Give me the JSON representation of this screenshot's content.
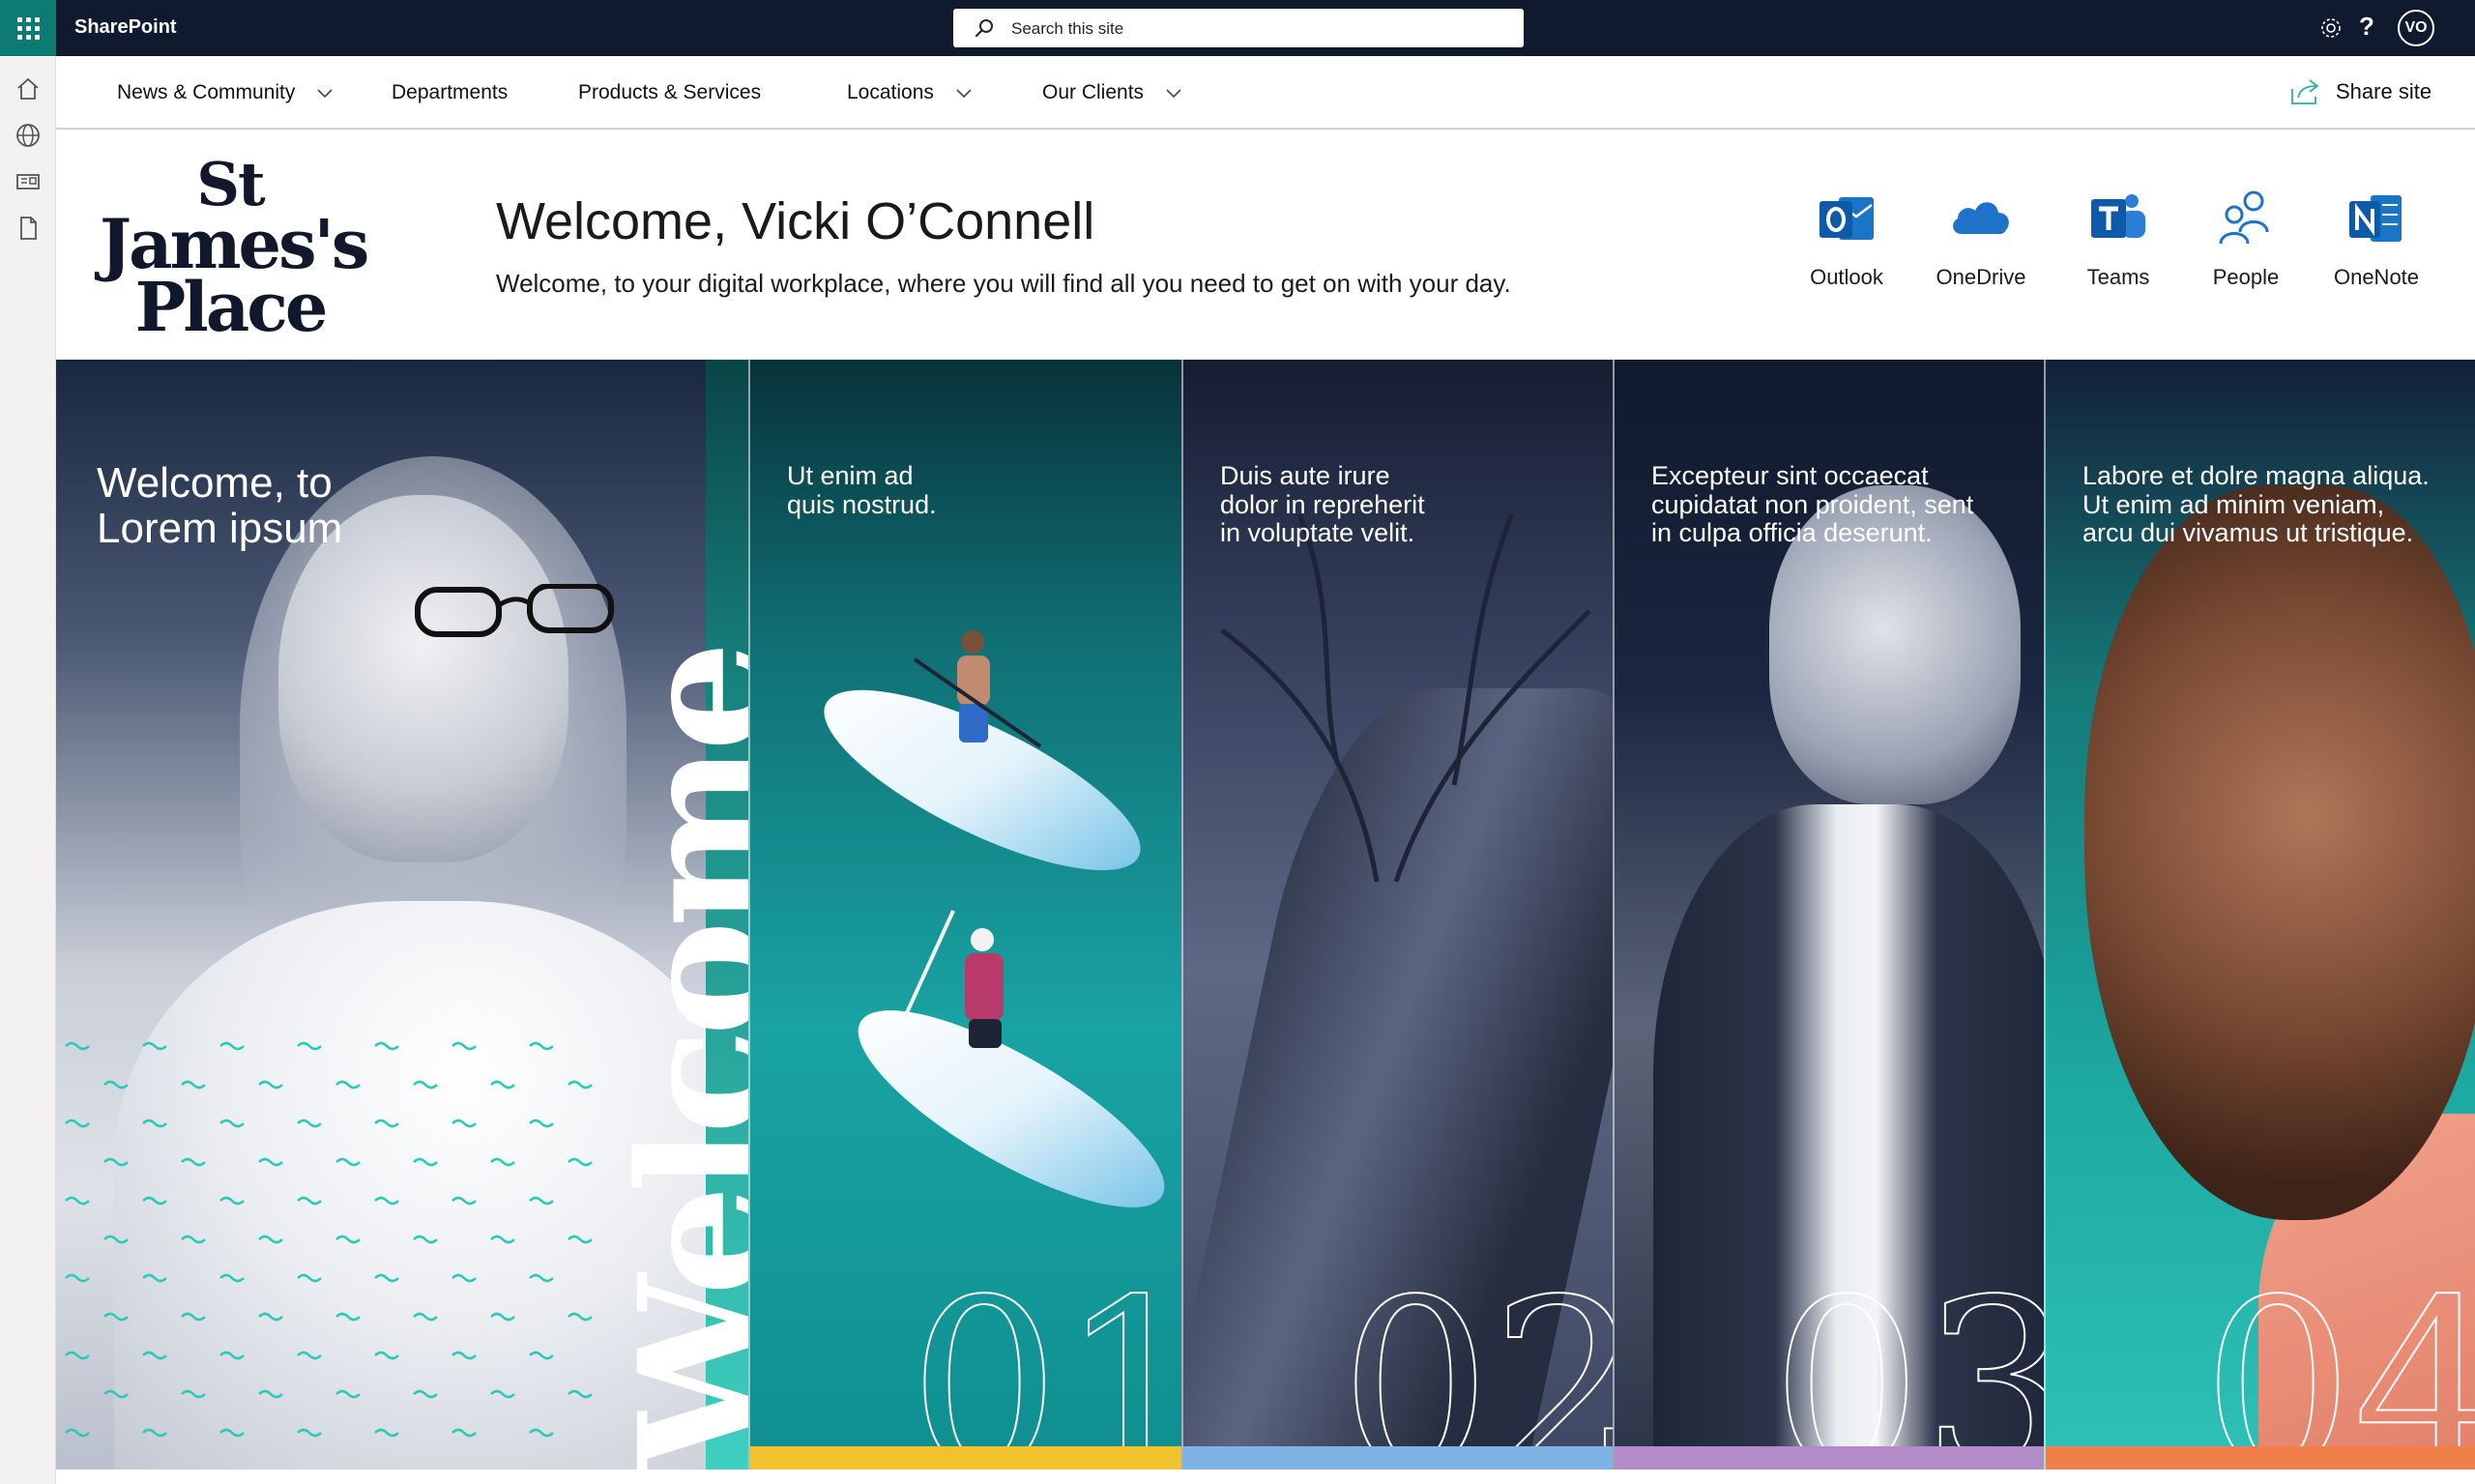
{
  "suitebar": {
    "app_name": "SharePoint",
    "search_placeholder": "Search this site",
    "help_label": "?",
    "avatar_initials": "VO",
    "accent_color": "#0e7a74",
    "bg_color": "#0f1a2e"
  },
  "leftrail": {
    "icons": [
      "home-icon",
      "globe-icon",
      "news-icon",
      "document-icon"
    ]
  },
  "nav": {
    "items": [
      {
        "label": "News & Community",
        "has_dropdown": true
      },
      {
        "label": "Departments",
        "has_dropdown": false
      },
      {
        "label": "Products & Services",
        "has_dropdown": false
      },
      {
        "label": "Locations",
        "has_dropdown": true
      },
      {
        "label": "Our Clients",
        "has_dropdown": true
      }
    ],
    "share_label": "Share site"
  },
  "header": {
    "logo_line1": "St",
    "logo_line2": "James's",
    "logo_line3": "Place",
    "title": "Welcome, Vicki O’Connell",
    "subtitle": "Welcome, to your digital workplace, where you will find all you need to get on with your day.",
    "apps": [
      {
        "label": "Outlook",
        "icon": "outlook-icon"
      },
      {
        "label": "OneDrive",
        "icon": "onedrive-icon"
      },
      {
        "label": "Teams",
        "icon": "teams-icon"
      },
      {
        "label": "People",
        "icon": "people-icon"
      },
      {
        "label": "OneNote",
        "icon": "onenote-icon"
      }
    ]
  },
  "hero": {
    "main_title": "Welcome, to\nLorem ipsum",
    "vertical_word": "Welcome",
    "panels": [
      {
        "text": "Ut enim ad\nquis nostrud.",
        "number": "01",
        "bar_color": "#f2c12e"
      },
      {
        "text": "Duis aute irure\ndolor in repreherit\nin voluptate velit.",
        "number": "02",
        "bar_color": "#7fb2e5"
      },
      {
        "text": "Excepteur sint occaecat\ncupidatat non proident, sent\nin culpa officia deserunt.",
        "number": "03",
        "bar_color": "#b58ac9"
      },
      {
        "text": "Labore et dolre magna aliqua.\nUt enim ad minim veniam,\narcu dui vivamus ut tristique.",
        "number": "04",
        "bar_color": "#f07f4a"
      }
    ]
  }
}
